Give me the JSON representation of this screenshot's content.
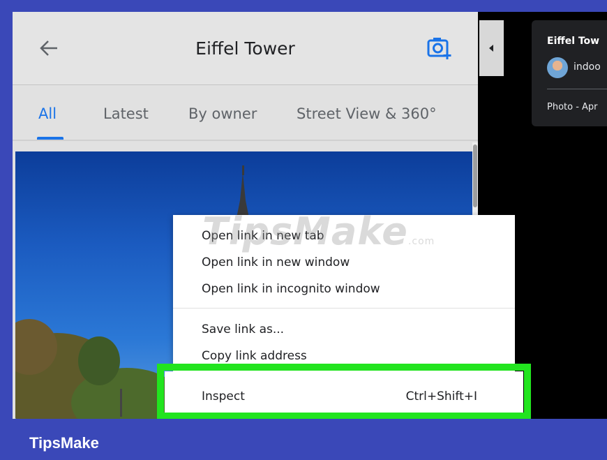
{
  "header": {
    "title": "Eiffel Tower",
    "back_icon": "arrow-left-icon",
    "camera_icon": "add-photo-icon"
  },
  "tabs": [
    {
      "label": "All",
      "active": true
    },
    {
      "label": "Latest",
      "active": false
    },
    {
      "label": "By owner",
      "active": false
    },
    {
      "label": "Street View & 360°",
      "active": false
    }
  ],
  "info_card": {
    "title": "Eiffel Tow",
    "user": "indoo",
    "date": "Photo - Apr"
  },
  "context_menu": {
    "items": [
      "Open link in new tab",
      "Open link in new window",
      "Open link in incognito window",
      "Save link as...",
      "Copy link address"
    ],
    "highlighted": {
      "label": "Inspect",
      "shortcut": "Ctrl+Shift+I"
    }
  },
  "watermark": {
    "text": "TipsMake",
    "suffix": ".com"
  },
  "footer": {
    "brand": "TipsMake"
  },
  "colors": {
    "accent": "#1a73e8",
    "highlight": "#22e41f",
    "frame": "#3a48b8"
  }
}
